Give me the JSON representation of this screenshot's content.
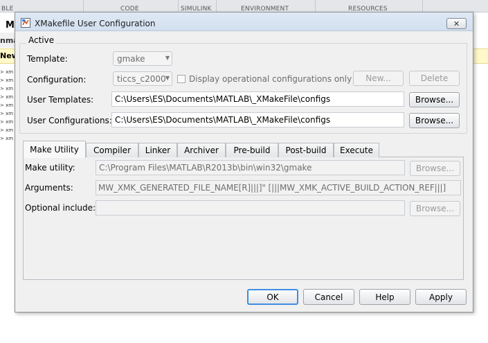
{
  "background_app": {
    "toolstrip_tabs": [
      "BLE",
      "CODE",
      "SIMULINK",
      "ENVIRONMENT",
      "RESOURCES"
    ],
    "left_title_fragment": "M",
    "left_header_fragment": "nma",
    "left_toolbar_fragment": "New",
    "left_lines": [
      "> xm",
      "> xm",
      "> xm",
      "> xm",
      "> xm",
      "> xm",
      "> xm",
      "> xm",
      "> xm"
    ]
  },
  "dialog": {
    "title": "XMakefile User Configuration",
    "close_glyph": "✕",
    "active_section": {
      "legend": "Active",
      "template_label": "Template:",
      "template_value": "gmake",
      "configuration_label": "Configuration:",
      "configuration_value": "ticcs_c2000",
      "display_operational_label": "Display operational configurations only",
      "new_button": "New...",
      "delete_button": "Delete",
      "user_templates_label": "User Templates:",
      "user_templates_value": "C:\\Users\\ES\\Documents\\MATLAB\\_XMakeFile\\configs",
      "user_configurations_label": "User Configurations:",
      "user_configurations_value": "C:\\Users\\ES\\Documents\\MATLAB\\_XMakeFile\\configs",
      "browse_button": "Browse..."
    },
    "tabs": [
      {
        "label": "Make Utility",
        "active": true
      },
      {
        "label": "Compiler",
        "active": false
      },
      {
        "label": "Linker",
        "active": false
      },
      {
        "label": "Archiver",
        "active": false
      },
      {
        "label": "Pre-build",
        "active": false
      },
      {
        "label": "Post-build",
        "active": false
      },
      {
        "label": "Execute",
        "active": false
      }
    ],
    "make_utility": {
      "make_utility_label": "Make utility:",
      "make_utility_value": "C:\\Program Files\\MATLAB\\R2013b\\bin\\win32\\gmake",
      "arguments_label": "Arguments:",
      "arguments_value": "MW_XMK_GENERATED_FILE_NAME[R]|||]\" [|||MW_XMK_ACTIVE_BUILD_ACTION_REF|||]",
      "optional_include_label": "Optional include:",
      "optional_include_value": "",
      "browse_button": "Browse..."
    },
    "footer": {
      "ok": "OK",
      "cancel": "Cancel",
      "help": "Help",
      "apply": "Apply"
    }
  },
  "colors": {
    "dialog_bg": "#f0f0f0",
    "titlebar": "#dbe6f3",
    "default_button_border": "#3d8ee0",
    "yellow_bar": "#fff8c9"
  }
}
